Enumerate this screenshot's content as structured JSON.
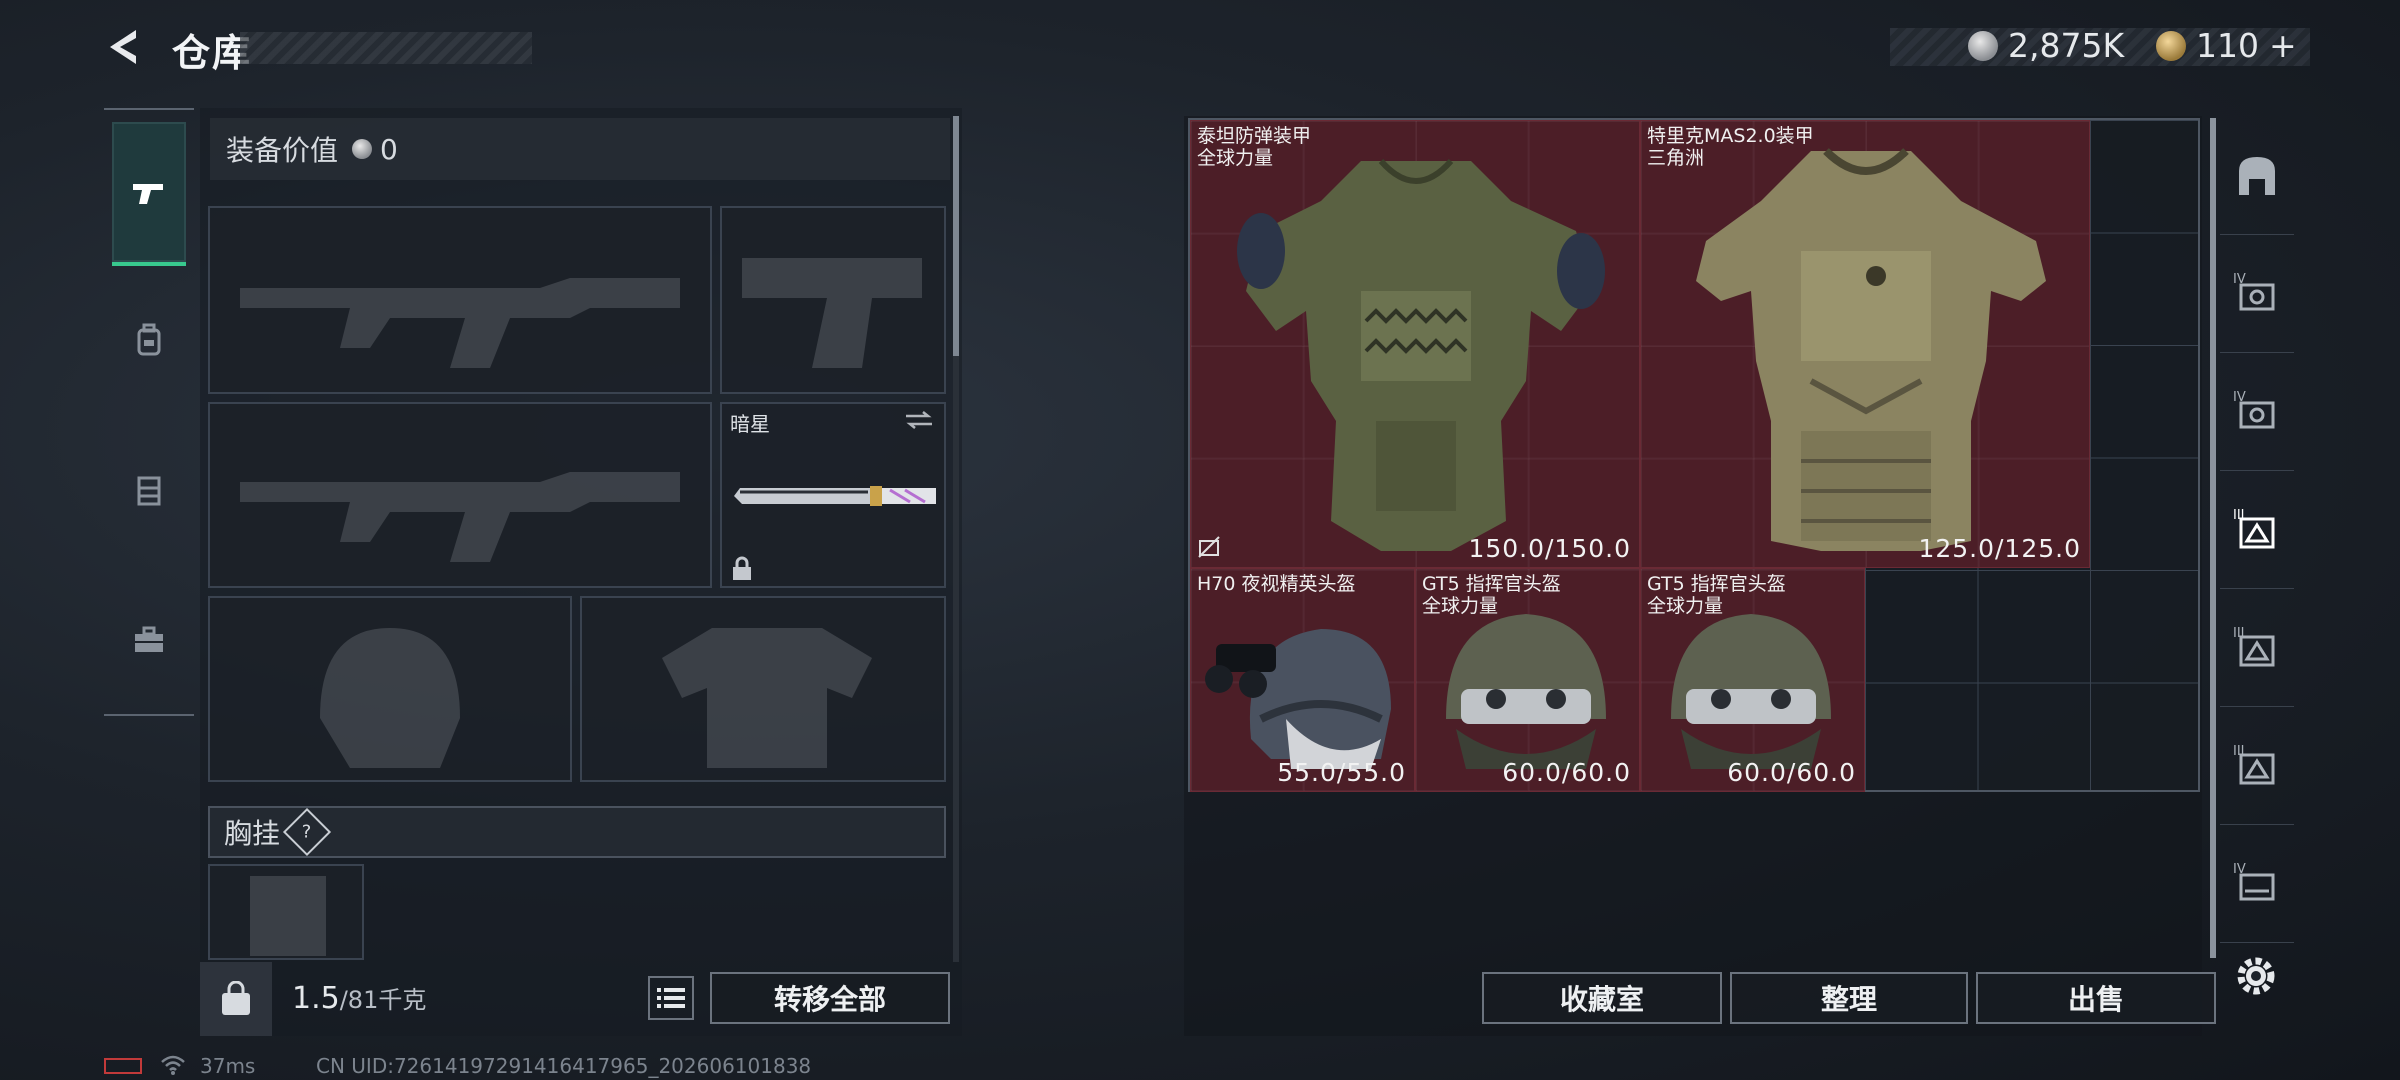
{
  "header": {
    "title": "仓库",
    "currency_silver": "2,875K",
    "currency_gold": "110",
    "currency_gold_plus": "+"
  },
  "tabs": [
    {
      "name": "weapons",
      "active": true
    },
    {
      "name": "backpack",
      "active": false
    },
    {
      "name": "chest-rig",
      "active": false
    },
    {
      "name": "toolbox",
      "active": false
    }
  ],
  "left": {
    "value_label": "装备价值",
    "value_amount": "0",
    "knife_slot_name": "暗星",
    "chest_rig_label": "胸挂",
    "chest_help": "?",
    "weight_current": "1.5",
    "weight_max": "/81千克",
    "transfer_all": "转移全部"
  },
  "items": [
    {
      "name_line1": "泰坦防弹装甲",
      "name_line2": "全球力量",
      "durability": "150.0/150.0"
    },
    {
      "name_line1": "特里克MAS2.0装甲",
      "name_line2": "三角洲",
      "durability": "125.0/125.0"
    },
    {
      "name_line1": "H70 夜视精英头盔",
      "name_line2": "",
      "durability": "55.0/55.0"
    },
    {
      "name_line1": "GT5 指挥官头盔",
      "name_line2": "全球力量",
      "durability": "60.0/60.0"
    },
    {
      "name_line1": "GT5 指挥官头盔",
      "name_line2": "全球力量",
      "durability": "60.0/60.0"
    }
  ],
  "filters": [
    "bag-filter",
    "armor-iv-filter",
    "armor-iv-filter-2",
    "armor-iii-active-filter",
    "helmet-iii-filter",
    "helmet-iii-filter-2",
    "armor-iv-filter-3"
  ],
  "buttons": {
    "collection": "收藏室",
    "organize": "整理",
    "sell": "出售"
  },
  "status": {
    "ping": "37ms",
    "uid": "CN UID:72614197291416417965_202606101838"
  }
}
